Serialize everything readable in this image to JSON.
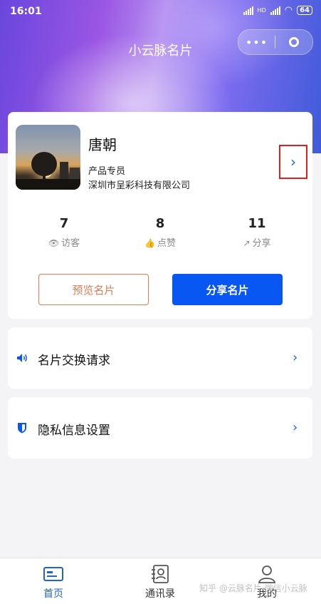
{
  "status_bar": {
    "time": "16:01",
    "network": "HD",
    "battery": "64"
  },
  "header": {
    "title": "小云脉名片",
    "capsule_more": "•••"
  },
  "profile": {
    "name": "唐朝",
    "role": "产品专员",
    "company": "深圳市呈彩科技有限公司",
    "arrow": "›"
  },
  "stats": [
    {
      "value": "7",
      "label": "访客",
      "icon": "eye-icon"
    },
    {
      "value": "8",
      "label": "点赞",
      "icon": "thumbs-up-icon"
    },
    {
      "value": "11",
      "label": "分享",
      "icon": "share-icon"
    }
  ],
  "actions": {
    "preview": "预览名片",
    "share": "分享名片"
  },
  "menu": [
    {
      "label": "名片交换请求",
      "icon": "speaker-icon",
      "arrow": "›"
    },
    {
      "label": "隐私信息设置",
      "icon": "shield-icon",
      "arrow": "›"
    }
  ],
  "tabs": [
    {
      "label": "首页",
      "icon": "card-icon",
      "active": true
    },
    {
      "label": "通讯录",
      "icon": "contacts-icon",
      "active": false
    },
    {
      "label": "我的",
      "icon": "person-icon",
      "active": false
    }
  ],
  "watermark": "知乎 @云脉名片·微信小云脉",
  "colors": {
    "accent": "#0957f2",
    "outline": "#e07b52",
    "arrow": "#1e63d6",
    "highlight_box": "#e02020"
  }
}
